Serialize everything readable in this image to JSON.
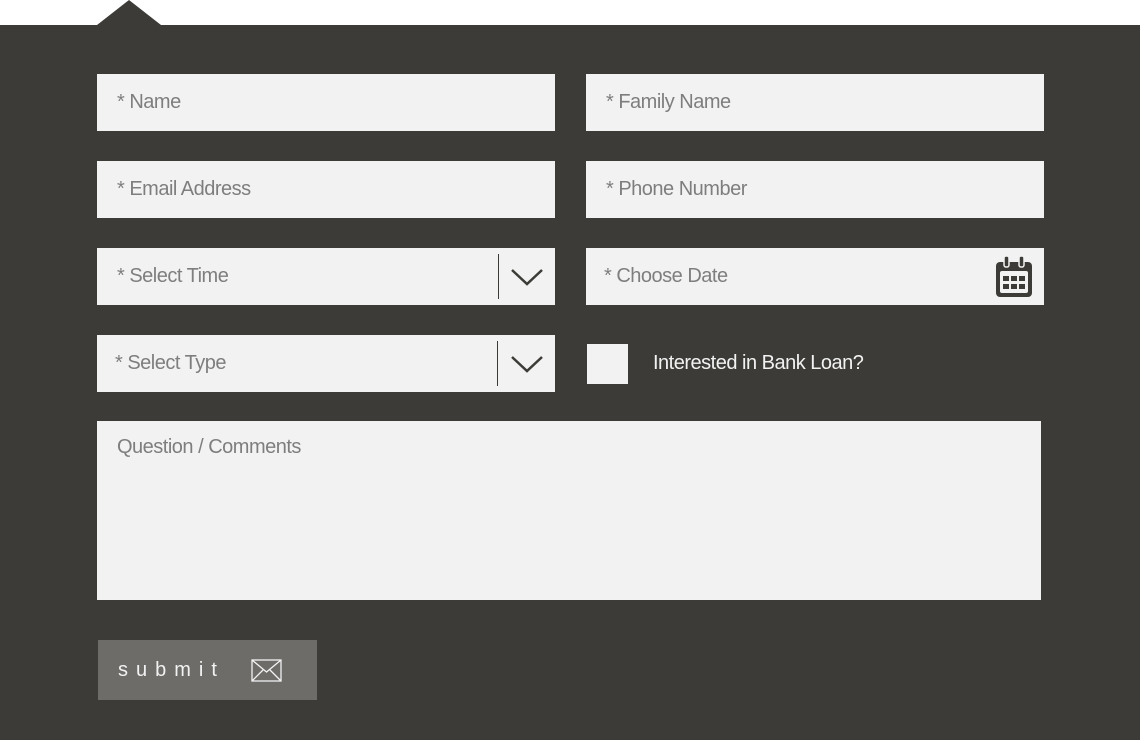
{
  "form": {
    "name_placeholder": "* Name",
    "family_name_placeholder": "* Family Name",
    "email_placeholder": "* Email Address",
    "phone_placeholder": "* Phone Number",
    "select_time_label": "* Select Time",
    "choose_date_placeholder": "* Choose Date",
    "select_type_label": "* Select Type",
    "bank_loan_label": "Interested in Bank Loan?",
    "comments_placeholder": "Question / Comments",
    "submit_label": "submit"
  },
  "icons": {
    "select_time": "chevron-down-icon",
    "select_type": "chevron-down-icon",
    "date": "calendar-icon",
    "submit": "envelope-icon"
  },
  "colors": {
    "panel_background": "#3c3b37",
    "field_background": "#f2f2f2",
    "placeholder_text": "#7e7e7e",
    "submit_background": "#6d6c69",
    "light_text": "#f2f2f2"
  }
}
